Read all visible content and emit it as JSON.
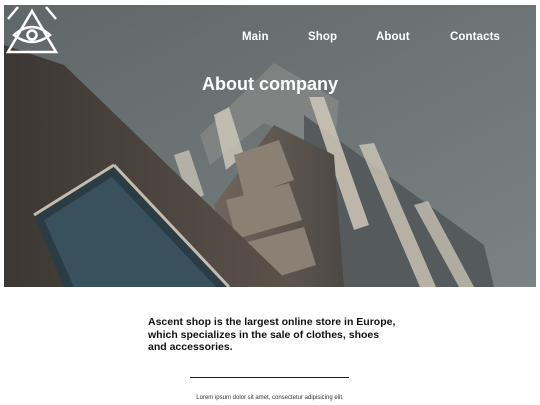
{
  "nav": {
    "items": [
      "Main",
      "Shop",
      "About",
      "Contacts"
    ]
  },
  "hero": {
    "title": "About company"
  },
  "content": {
    "intro": "Ascent shop is the largest online store in Europe, which specializes in the sale of clothes, shoes and accessories.",
    "body": "Lorem ipsum dolor sit amet, consectetur adipisicing elit,"
  },
  "icons": {
    "logo": "eye-triangle-logo-icon"
  },
  "colors": {
    "hero_overlay": "#6e7677",
    "nav_text": "#ffffff",
    "text": "#111111"
  }
}
